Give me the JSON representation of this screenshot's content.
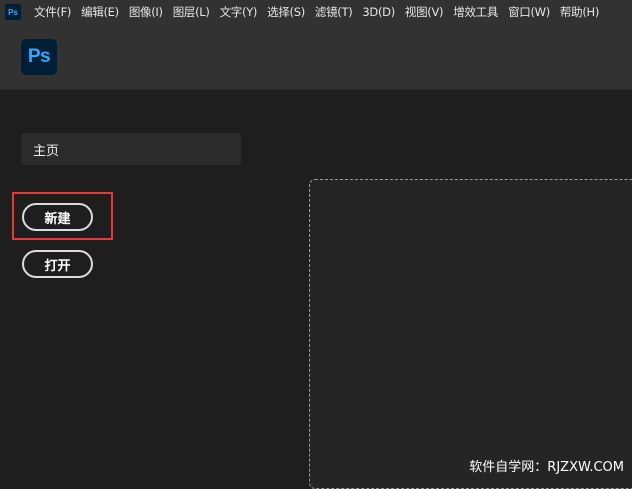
{
  "menubar": {
    "app_icon": "Ps",
    "items": [
      {
        "label": "文件(F)"
      },
      {
        "label": "编辑(E)"
      },
      {
        "label": "图像(I)"
      },
      {
        "label": "图层(L)"
      },
      {
        "label": "文字(Y)"
      },
      {
        "label": "选择(S)"
      },
      {
        "label": "滤镜(T)"
      },
      {
        "label": "3D(D)"
      },
      {
        "label": "视图(V)"
      },
      {
        "label": "增效工具"
      },
      {
        "label": "窗口(W)"
      },
      {
        "label": "帮助(H)"
      }
    ]
  },
  "header": {
    "logo": "Ps"
  },
  "sidebar": {
    "home_label": "主页",
    "new_label": "新建",
    "open_label": "打开"
  },
  "watermark": "软件自学网：RJZXW.COM",
  "colors": {
    "accent_blue": "#31a8ff",
    "highlight_red": "#e53935",
    "background": "#1e1e1e",
    "header": "#323232"
  }
}
